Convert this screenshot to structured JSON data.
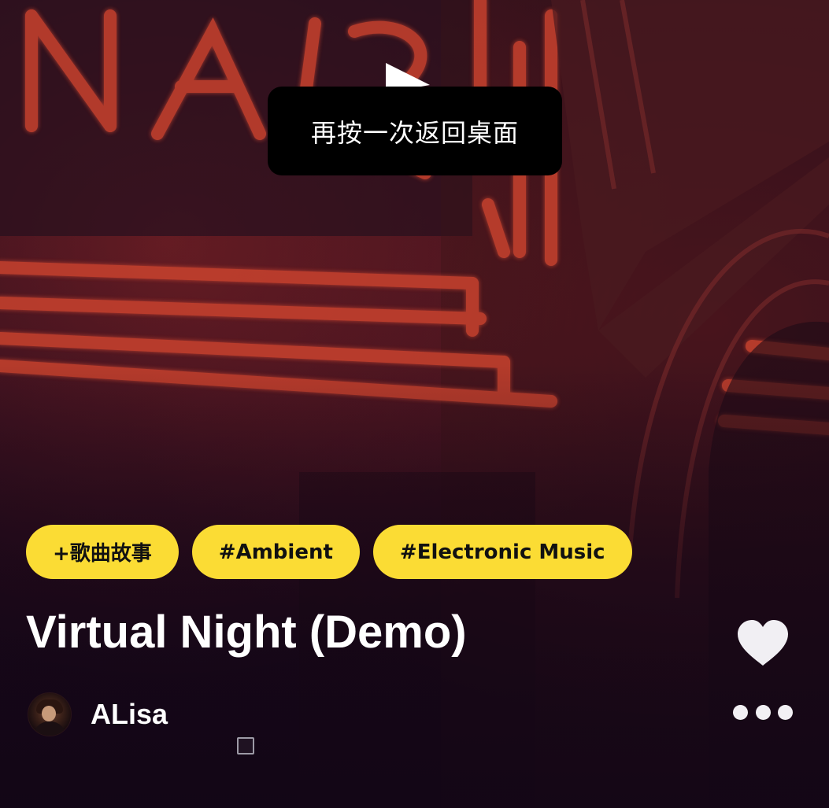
{
  "toast": {
    "message": "再按一次返回桌面"
  },
  "tags": [
    {
      "label": "+歌曲故事"
    },
    {
      "label": "#Ambient"
    },
    {
      "label": "#Electronic Music"
    }
  ],
  "song": {
    "title": "Virtual Night (Demo)",
    "liked": true
  },
  "artist": {
    "name": "ALisa"
  },
  "icons": {
    "play": "play-icon",
    "like": "heart-icon",
    "more": "more-dots-icon",
    "avatar": "avatar"
  },
  "colors": {
    "tag_bg": "#fbdc34",
    "tag_text": "#111111",
    "toast_bg": "#000000",
    "text": "#ffffff",
    "neon": "#c0392b"
  }
}
